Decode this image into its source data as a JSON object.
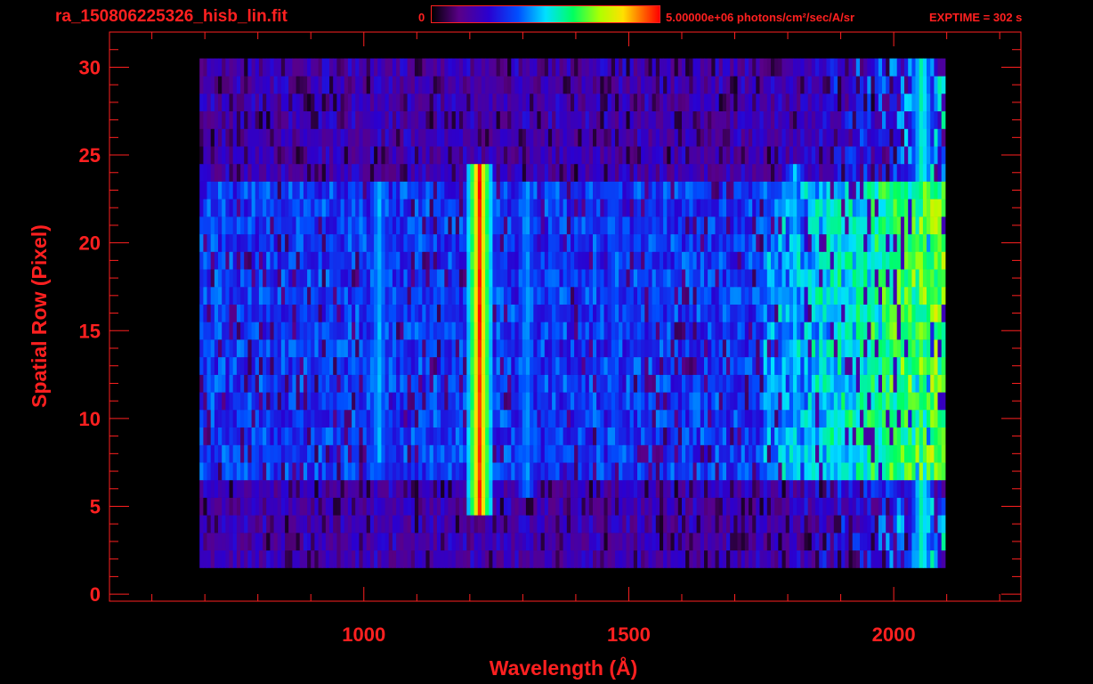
{
  "header": {
    "title": "ra_150806225326_hisb_lin.fit",
    "colorbar_min": "0",
    "colorbar_max": "5.00000e+06 photons/cm²/sec/A/sr",
    "exptime": "EXPTIME = 302 s"
  },
  "colors": {
    "axis": "#ff2020",
    "background": "#000000"
  },
  "chart_data": {
    "type": "heatmap",
    "title": "ra_150806225326_hisb_lin.fit",
    "xlabel": "Wavelength (Å)",
    "ylabel": "Spatial Row (Pixel)",
    "xlim": [
      520,
      2240
    ],
    "ylim": [
      -0.4,
      32
    ],
    "x_ticks": [
      1000,
      1500,
      2000
    ],
    "y_ticks": [
      0,
      5,
      10,
      15,
      20,
      25,
      30
    ],
    "colorbar": {
      "min": 0,
      "max": 5000000,
      "units": "photons/cm²/sec/A/sr",
      "colormap": "rainbow"
    },
    "rows_range": [
      2,
      30
    ],
    "wavelength_range": [
      690,
      2090
    ],
    "emission_lines": [
      {
        "wavelength": 1025,
        "relative_intensity": 0.45,
        "rows": [
          8,
          23
        ]
      },
      {
        "wavelength": 1215,
        "relative_intensity": 0.95,
        "rows": [
          5,
          24
        ]
      },
      {
        "wavelength": 1304,
        "relative_intensity": 0.42,
        "rows": [
          6,
          23
        ]
      },
      {
        "wavelength": 1356,
        "relative_intensity": 0.32,
        "rows": [
          7,
          23
        ]
      },
      {
        "wavelength": 1470,
        "relative_intensity": 0.36,
        "rows": [
          8,
          23
        ]
      },
      {
        "wavelength": 1810,
        "relative_intensity": 0.45,
        "rows": [
          7,
          24
        ]
      },
      {
        "wavelength": 2050,
        "relative_intensity": 0.55,
        "rows": [
          2,
          30
        ]
      }
    ]
  }
}
